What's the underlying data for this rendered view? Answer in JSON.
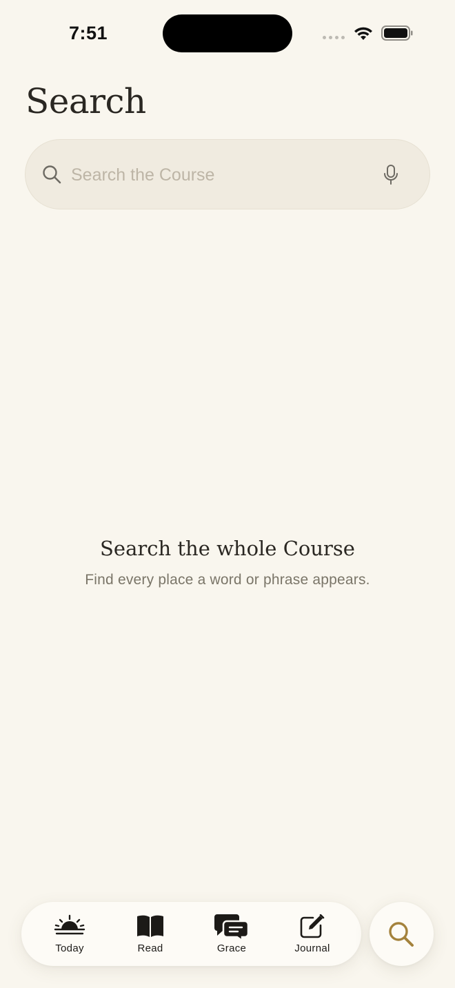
{
  "status_bar": {
    "time": "7:51"
  },
  "page": {
    "title": "Search"
  },
  "search": {
    "placeholder": "Search the Course",
    "value": ""
  },
  "empty_state": {
    "title": "Search the whole Course",
    "subtitle": "Find every place a word or phrase appears."
  },
  "tab_bar": {
    "tabs": [
      {
        "label": "Today",
        "icon": "sunrise-icon"
      },
      {
        "label": "Read",
        "icon": "book-icon"
      },
      {
        "label": "Grace",
        "icon": "chat-bubbles-icon"
      },
      {
        "label": "Journal",
        "icon": "compose-icon"
      }
    ]
  },
  "search_button": {
    "icon": "search-icon"
  },
  "colors": {
    "background": "#f9f6ee",
    "search_field": "#f0ebe0",
    "accent": "#a4823c",
    "text": "#2a2722",
    "muted_text": "#7a7568"
  }
}
